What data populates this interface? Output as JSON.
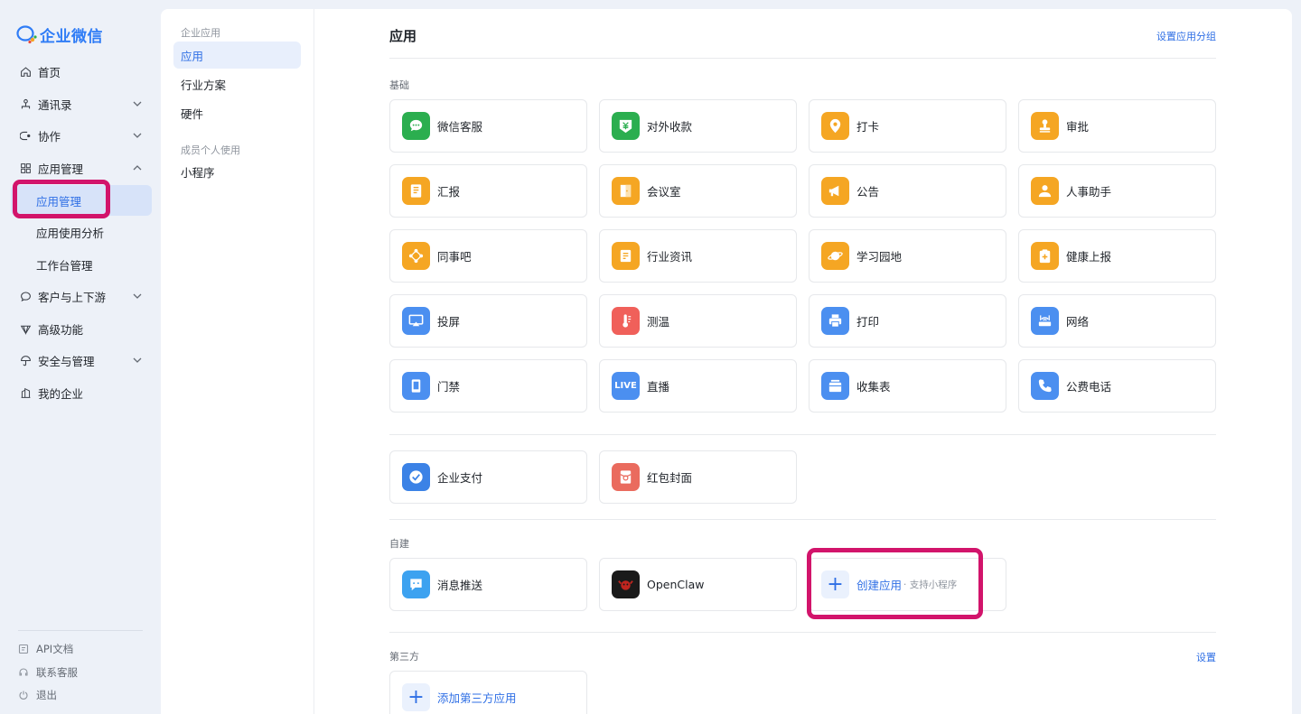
{
  "app": {
    "logo_text": "企业微信"
  },
  "nav": {
    "items": [
      {
        "label": "首页",
        "icon": "home-icon"
      },
      {
        "label": "通讯录",
        "icon": "org-chart-icon"
      },
      {
        "label": "协作",
        "icon": "collab-icon"
      },
      {
        "label": "应用管理",
        "icon": "apps-grid-icon"
      },
      {
        "label": "应用管理"
      },
      {
        "label": "应用使用分析"
      },
      {
        "label": "工作台管理"
      },
      {
        "label": "客户与上下游",
        "icon": "chat-bubble-icon"
      },
      {
        "label": "高级功能",
        "icon": "diamond-icon"
      },
      {
        "label": "安全与管理",
        "icon": "umbrella-icon"
      },
      {
        "label": "我的企业",
        "icon": "building-icon"
      }
    ],
    "bottom": [
      {
        "label": "API文档",
        "icon": "doc-icon"
      },
      {
        "label": "联系客服",
        "icon": "headset-icon"
      },
      {
        "label": "退出",
        "icon": "power-icon"
      }
    ]
  },
  "subnav": {
    "caption1": "企业应用",
    "items1": [
      "应用",
      "行业方案",
      "硬件"
    ],
    "caption2": "成员个人使用",
    "items2": [
      "小程序"
    ]
  },
  "main": {
    "title": "应用",
    "group_link": "设置应用分组",
    "basic_label": "基础",
    "self_label": "自建",
    "third_label": "第三方",
    "third_settings": "设置",
    "basic_apps": [
      {
        "label": "微信客服",
        "icon": "wechat-cs-icon",
        "color": "#2bae4f"
      },
      {
        "label": "对外收款",
        "icon": "yuan-icon",
        "color": "#2bae4f"
      },
      {
        "label": "打卡",
        "icon": "location-pin-icon",
        "color": "#f5a623"
      },
      {
        "label": "审批",
        "icon": "stamp-icon",
        "color": "#f5a623"
      },
      {
        "label": "汇报",
        "icon": "report-icon",
        "color": "#f5a623"
      },
      {
        "label": "会议室",
        "icon": "door-icon",
        "color": "#f5a623"
      },
      {
        "label": "公告",
        "icon": "megaphone-icon",
        "color": "#f5a623"
      },
      {
        "label": "人事助手",
        "icon": "person-icon",
        "color": "#f5a623"
      },
      {
        "label": "同事吧",
        "icon": "network-icon",
        "color": "#f5a623"
      },
      {
        "label": "行业资讯",
        "icon": "news-icon",
        "color": "#f5a623"
      },
      {
        "label": "学习园地",
        "icon": "planet-icon",
        "color": "#f5a623"
      },
      {
        "label": "健康上报",
        "icon": "health-clipboard-icon",
        "color": "#f5a623"
      },
      {
        "label": "投屏",
        "icon": "screen-cast-icon",
        "color": "#4b8ff0"
      },
      {
        "label": "测温",
        "icon": "thermometer-icon",
        "color": "#f0605a"
      },
      {
        "label": "打印",
        "icon": "printer-icon",
        "color": "#4b8ff0"
      },
      {
        "label": "网络",
        "icon": "router-icon",
        "color": "#4b8ff0"
      },
      {
        "label": "门禁",
        "icon": "access-door-icon",
        "color": "#4b8ff0"
      },
      {
        "label": "直播",
        "icon": "live-icon",
        "color": "#4b8ff0",
        "badge": "LIVE"
      },
      {
        "label": "收集表",
        "icon": "collect-form-icon",
        "color": "#4b8ff0"
      },
      {
        "label": "公费电话",
        "icon": "phone-icon",
        "color": "#4b8ff0"
      }
    ],
    "pay_apps": [
      {
        "label": "企业支付",
        "icon": "pay-icon",
        "color": "#3b82e6"
      },
      {
        "label": "红包封面",
        "icon": "red-packet-icon",
        "color": "#ea6b5e"
      }
    ],
    "self_apps": [
      {
        "label": "消息推送",
        "icon": "message-push-icon",
        "color": "#3da2f0"
      },
      {
        "label": "OpenClaw",
        "icon": "openclaw-icon",
        "color": "#1a1a1a"
      }
    ],
    "create": {
      "label": "创建应用",
      "sub": "· 支持小程序"
    },
    "add_third": "添加第三方应用"
  }
}
